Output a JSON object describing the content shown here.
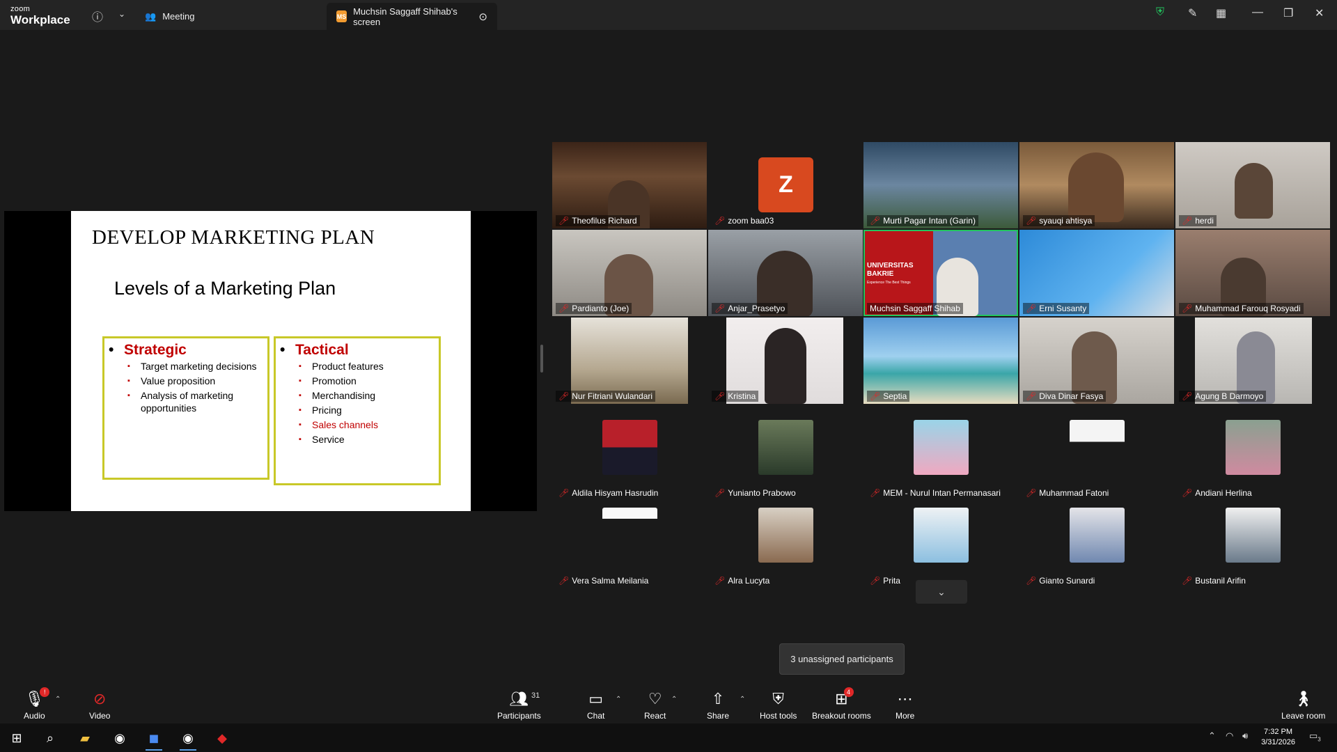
{
  "app": {
    "logo_small": "zoom",
    "logo_big": "Workplace"
  },
  "tabs": [
    {
      "label": "Meeting",
      "icon": "people-icon"
    },
    {
      "label": "Muchsin Saggaff Shihab's screen",
      "badge": "MS",
      "icon": "more-icon"
    }
  ],
  "shared_slide": {
    "title": "DEVELOP MARKETING PLAN",
    "subtitle": "Levels of a Marketing Plan",
    "strategic": {
      "heading": "Strategic",
      "items": [
        "Target marketing decisions",
        "Value proposition",
        "Analysis of marketing opportunities"
      ]
    },
    "tactical": {
      "heading": "Tactical",
      "items": [
        "Product features",
        "Promotion",
        "Merchandising",
        "Pricing",
        "Sales channels",
        "Service"
      ]
    }
  },
  "video_tiles": [
    {
      "name": "Theofilus Richard"
    },
    {
      "name": "zoom baa03",
      "avatar_letter": "Z"
    },
    {
      "name": "Murti Pagar Intan (Garin)"
    },
    {
      "name": "syauqi ahtisya"
    },
    {
      "name": "herdi"
    },
    {
      "name": "Pardianto (Joe)"
    },
    {
      "name": "Anjar_Prasetyo"
    },
    {
      "name": "Muchsin Saggaff Shihab",
      "banner_line1": "UNIVERSITAS",
      "banner_line2": "BAKRIE",
      "banner_tagline": "Experience The Best Things"
    },
    {
      "name": "Erni Susanty"
    },
    {
      "name": "Muhammad Farouq Rosyadi"
    },
    {
      "name": "Nur Fitriani Wulandari"
    },
    {
      "name": "Kristina"
    },
    {
      "name": "Septia"
    },
    {
      "name": "Diva Dinar Fasya"
    },
    {
      "name": "Agung B Darmoyo"
    },
    {
      "name": "Aldila Hisyam Hasrudin"
    },
    {
      "name": "Yunianto Prabowo"
    },
    {
      "name": "MEM - Nurul Intan Permanasari"
    },
    {
      "name": "Muhammad Fatoni"
    },
    {
      "name": "Andiani Herlina"
    },
    {
      "name": "Vera Salma Meilania"
    },
    {
      "name": "Alra Lucyta"
    },
    {
      "name": "Prita"
    },
    {
      "name": "Gianto Sunardi"
    },
    {
      "name": "Bustanil Arifin"
    }
  ],
  "tooltip": "3 unassigned participants",
  "toolbar": {
    "audio": "Audio",
    "video": "Video",
    "participants": "Participants",
    "participants_count": "31",
    "chat": "Chat",
    "react": "React",
    "share": "Share",
    "host_tools": "Host tools",
    "breakout_rooms": "Breakout rooms",
    "breakout_badge": "4",
    "more": "More",
    "leave": "Leave room"
  },
  "taskbar": {
    "time": "7:32 PM",
    "date": "3/31/2026",
    "notif_count": "3"
  },
  "colors": {
    "accent_red": "#c00000",
    "box_border": "#c8c828",
    "zoom_orange": "#d8491f",
    "speaker_green": "#22c55e"
  }
}
